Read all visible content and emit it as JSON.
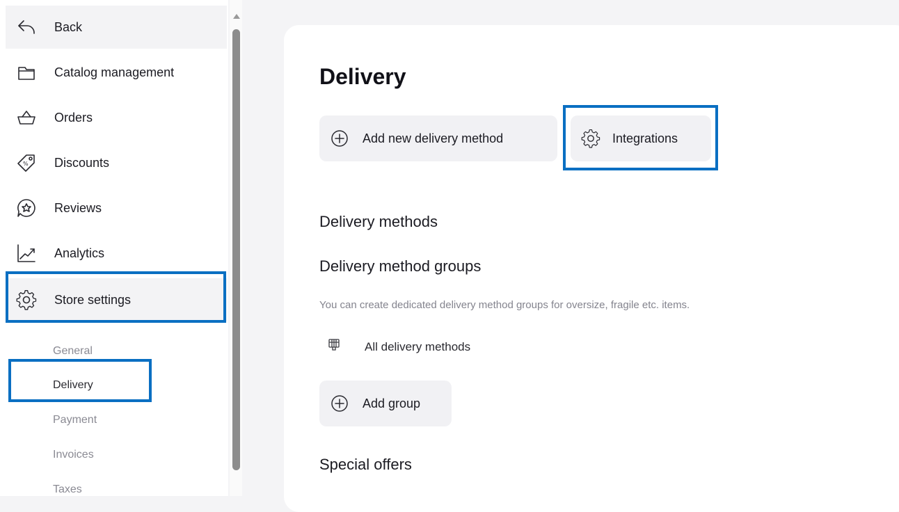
{
  "sidebar": {
    "back_label": "Back",
    "items": [
      {
        "label": "Catalog management",
        "icon": "folder-icon"
      },
      {
        "label": "Orders",
        "icon": "basket-icon"
      },
      {
        "label": "Discounts",
        "icon": "tag-icon"
      },
      {
        "label": "Reviews",
        "icon": "star-chat-icon"
      },
      {
        "label": "Analytics",
        "icon": "chart-icon"
      },
      {
        "label": "Store settings",
        "icon": "gear-icon"
      }
    ],
    "subitems": [
      "General",
      "Delivery",
      "Payment",
      "Invoices",
      "Taxes"
    ],
    "active_subitem": "Delivery"
  },
  "main": {
    "title": "Delivery",
    "buttons": {
      "add_method": "Add new delivery method",
      "integrations": "Integrations",
      "add_group": "Add group"
    },
    "sections": {
      "methods": "Delivery methods",
      "groups": "Delivery method groups",
      "groups_description": "You can create dedicated delivery method groups for oversize, fragile etc. items.",
      "all_methods": "All delivery methods",
      "special_offers": "Special offers"
    }
  },
  "colors": {
    "highlight": "#0a6fc2",
    "background": "#f4f4f6",
    "button_bg": "#f1f1f4"
  }
}
